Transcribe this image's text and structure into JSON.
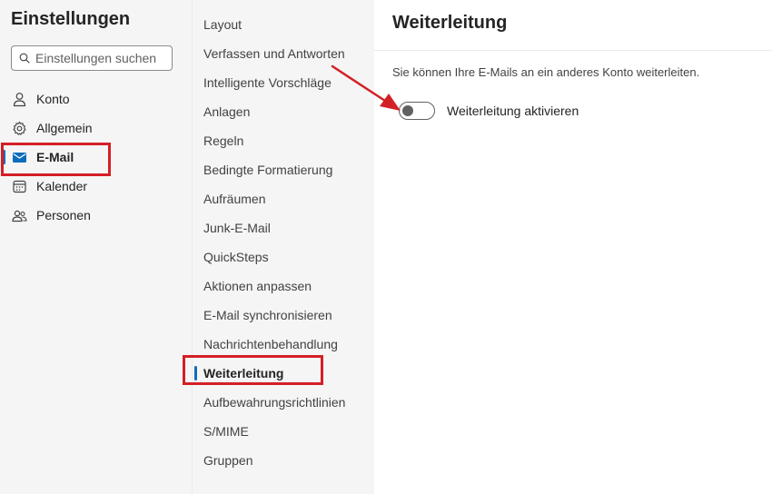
{
  "settings": {
    "title": "Einstellungen",
    "search_placeholder": "Einstellungen suchen"
  },
  "categories": [
    {
      "label": "Konto",
      "icon": "person-icon"
    },
    {
      "label": "Allgemein",
      "icon": "gear-icon"
    },
    {
      "label": "E-Mail",
      "icon": "mail-icon",
      "active": true
    },
    {
      "label": "Kalender",
      "icon": "calendar-icon"
    },
    {
      "label": "Personen",
      "icon": "people-icon"
    }
  ],
  "mail_sections": [
    {
      "label": "Layout"
    },
    {
      "label": "Verfassen und Antworten"
    },
    {
      "label": "Intelligente Vorschläge"
    },
    {
      "label": "Anlagen"
    },
    {
      "label": "Regeln"
    },
    {
      "label": "Bedingte Formatierung"
    },
    {
      "label": "Aufräumen"
    },
    {
      "label": "Junk-E-Mail"
    },
    {
      "label": "QuickSteps"
    },
    {
      "label": "Aktionen anpassen"
    },
    {
      "label": "E-Mail synchronisieren"
    },
    {
      "label": "Nachrichtenbehandlung"
    },
    {
      "label": "Weiterleitung",
      "active": true
    },
    {
      "label": "Aufbewahrungsrichtlinien"
    },
    {
      "label": "S/MIME"
    },
    {
      "label": "Gruppen"
    }
  ],
  "panel": {
    "title": "Weiterleitung",
    "description": "Sie können Ihre E-Mails an ein anderes Konto weiterleiten.",
    "toggle_label": "Weiterleitung aktivieren",
    "toggle_on": false
  },
  "colors": {
    "accent": "#0f6cbd",
    "annotation": "#d41f26"
  }
}
